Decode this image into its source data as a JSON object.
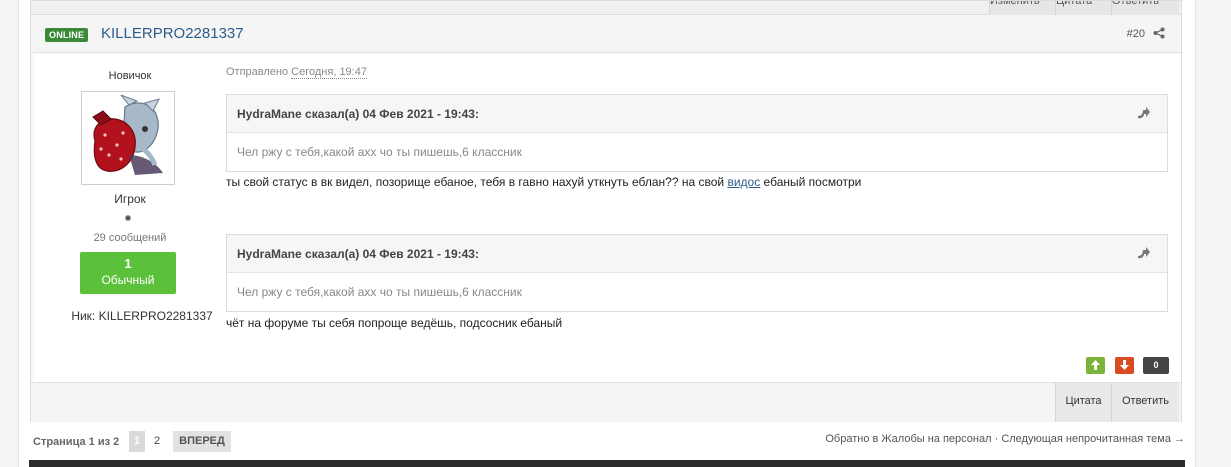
{
  "prev_post": {
    "edit_label": "Изменить",
    "quote_label": "Цитата",
    "reply_label": "Ответить"
  },
  "post": {
    "online_badge": "ONLINE",
    "username": "KILLERPRO2281337",
    "number": "#20",
    "posted_prefix": "Отправлено",
    "posted_date": "Сегодня, 19:47",
    "author": {
      "rank_title": "Новичок",
      "group": "Игрок",
      "posts_count": "29 сообщений",
      "reputation_value": "1",
      "reputation_label": "Обычный",
      "nick": "Ник: KILLERPRO2281337"
    },
    "quotes": [
      {
        "citation": "HydraMane сказал(а) 04 Фев 2021 - 19:43:",
        "text": "Чел ржу с тебя,какой ахх чо ты пишешь,6 классник",
        "reply_before_link": "ты свой статус в вк видел, позорище ебаное, тебя в гавно нахуй уткнуть еблан?? на свой ",
        "reply_link": "видос",
        "reply_after_link": " ебаный посмотри"
      },
      {
        "citation": "HydraMane сказал(а) 04 Фев 2021 - 19:43:",
        "text": "Чел ржу с тебя,какой ахх чо ты пишешь,6 классник",
        "reply": "чёт на форуме ты себя попроще ведёшь, подсосник ебаный"
      }
    ],
    "vote_count": "0",
    "quote_button": "Цитата",
    "reply_button": "Ответить"
  },
  "pagination": {
    "label": "Страница 1 из 2",
    "current": "1",
    "next_page": "2",
    "forward": "ВПЕРЕД"
  },
  "bottom_links": {
    "back": "Обратно в Жалобы на персонал",
    "separator": "·",
    "next_unread": "Следующая непрочитанная тема →"
  },
  "colors": {
    "online": "#3a8a3a",
    "username": "#2c5c8a",
    "reputation": "#5cc13a",
    "vote_up": "#7bb43a",
    "vote_down": "#d94b20"
  },
  "icons": [
    "share-icon",
    "quote-icon",
    "arrow-up-icon",
    "arrow-down-icon"
  ]
}
